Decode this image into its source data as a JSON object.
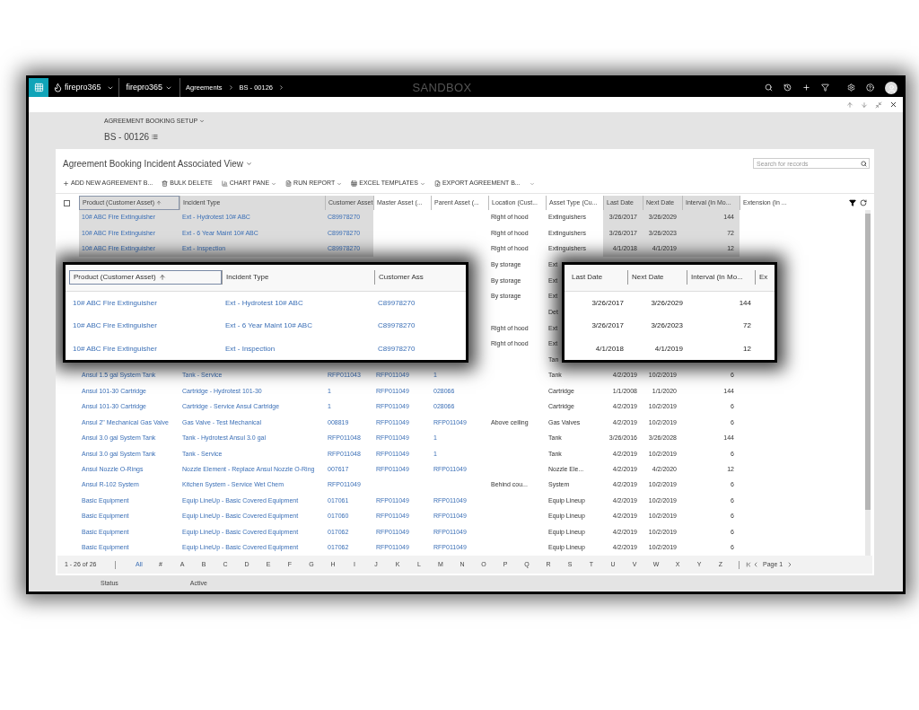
{
  "top_bar": {
    "app_name": "firepro365",
    "area": "firepro365",
    "breadcrumbs": [
      "Agreements",
      "BS - 00126"
    ],
    "environment": "SANDBOX"
  },
  "form": {
    "entity_label": "AGREEMENT BOOKING SETUP",
    "record_name": "BS - 00126"
  },
  "view": {
    "title": "Agreement Booking Incident Associated View",
    "search": {
      "placeholder": "Search for records"
    },
    "commands": [
      {
        "label": "ADD NEW AGREEMENT B...",
        "kind": "add",
        "has_menu": false
      },
      {
        "label": "BULK DELETE",
        "kind": "delete",
        "has_menu": false
      },
      {
        "label": "CHART PANE",
        "kind": "chart",
        "has_menu": true
      },
      {
        "label": "RUN REPORT",
        "kind": "report",
        "has_menu": true
      },
      {
        "label": "EXCEL TEMPLATES",
        "kind": "excel",
        "has_menu": true
      },
      {
        "label": "EXPORT AGREEMENT B...",
        "kind": "export",
        "has_menu": false
      }
    ],
    "columns": [
      {
        "label": "Product (Customer Asset)",
        "kind": "link",
        "highlighted": true,
        "sorted": true
      },
      {
        "label": "Incident Type",
        "kind": "link",
        "highlighted": true,
        "sorted": false
      },
      {
        "label": "Customer Asset",
        "kind": "link",
        "highlighted": true,
        "sorted": false
      },
      {
        "label": "Master Asset (...",
        "kind": "link",
        "highlighted": false,
        "sorted": false
      },
      {
        "label": "Parent Asset (...",
        "kind": "link",
        "highlighted": false,
        "sorted": false
      },
      {
        "label": "Location (Cust...",
        "kind": "text",
        "highlighted": false,
        "sorted": false
      },
      {
        "label": "Asset Type (Cu...",
        "kind": "text",
        "highlighted": false,
        "sorted": false
      },
      {
        "label": "Last Date",
        "kind": "number",
        "highlighted": true,
        "sorted": false
      },
      {
        "label": "Next Date",
        "kind": "number",
        "highlighted": true,
        "sorted": false
      },
      {
        "label": "Interval (In Mo...",
        "kind": "number",
        "highlighted": true,
        "sorted": false
      },
      {
        "label": "Extension (In ...",
        "highlighted": false,
        "sorted": false
      }
    ],
    "select_all": {
      "checked": false
    },
    "rows": [
      {
        "highlighted": true,
        "product": "10# ABC Fire Extinguisher",
        "incident_type": "Ext - Hydrotest 10# ABC",
        "customer_asset": "C89978270",
        "location": "Right of hood",
        "asset_type": "Extinguishers",
        "last_date": "3/26/2017",
        "next_date": "3/26/2029",
        "interval": "144"
      },
      {
        "highlighted": true,
        "product": "10# ABC Fire Extinguisher",
        "incident_type": "Ext - 6 Year Maint 10# ABC",
        "customer_asset": "C89978270",
        "location": "Right of hood",
        "asset_type": "Extinguishers",
        "last_date": "3/26/2017",
        "next_date": "3/26/2023",
        "interval": "72"
      },
      {
        "highlighted": true,
        "product": "10# ABC Fire Extinguisher",
        "incident_type": "Ext - Inspection",
        "customer_asset": "C89978270",
        "location": "Right of hood",
        "asset_type": "Extinguishers",
        "last_date": "4/1/2018",
        "next_date": "4/1/2019",
        "interval": "12"
      }
    ],
    "covered_rows": [
      {
        "location": "By storage",
        "asset_type": "Ext"
      },
      {
        "location": "By storage",
        "asset_type": "Ext"
      },
      {
        "location": "By storage",
        "asset_type": "Ext"
      },
      {
        "asset_type": "Det"
      },
      {
        "location": "Right of hood",
        "asset_type": "Ext"
      },
      {
        "location": "Right of hood",
        "asset_type": "Ext"
      },
      {
        "asset_type": "Tan"
      }
    ],
    "more_rows": [
      {
        "highlighted": false,
        "product": "Ansul 1.5 gal System Tank",
        "incident_type": "Tank - Service",
        "customer_asset": "RFP011043",
        "master_asset": "RFP011049",
        "parent_asset": "1",
        "asset_type": "Tank",
        "last_date": "4/2/2019",
        "next_date": "10/2/2019",
        "interval": "6"
      },
      {
        "highlighted": false,
        "product": "Ansul 101-30 Cartridge",
        "incident_type": "Cartridge - Hydrotest 101-30",
        "customer_asset": "1",
        "master_asset": "RFP011049",
        "parent_asset": "028066",
        "asset_type": "Cartridge",
        "last_date": "1/1/2008",
        "next_date": "1/1/2020",
        "interval": "144"
      },
      {
        "highlighted": false,
        "product": "Ansul 101-30 Cartridge",
        "incident_type": "Cartridge - Service Ansul Cartridge",
        "customer_asset": "1",
        "master_asset": "RFP011049",
        "parent_asset": "028066",
        "asset_type": "Cartridge",
        "last_date": "4/2/2019",
        "next_date": "10/2/2019",
        "interval": "6"
      },
      {
        "highlighted": false,
        "product": "Ansul 2\" Mechanical Gas Valve",
        "incident_type": "Gas Valve - Test Mechanical",
        "customer_asset": "008819",
        "master_asset": "RFP011049",
        "parent_asset": "RFP011049",
        "location": "Above ceiling",
        "asset_type": "Gas Valves",
        "last_date": "4/2/2019",
        "next_date": "10/2/2019",
        "interval": "6"
      },
      {
        "highlighted": false,
        "product": "Ansul 3.0 gal System Tank",
        "incident_type": "Tank - Hydrotest Ansul 3.0 gal",
        "customer_asset": "RFP011048",
        "master_asset": "RFP011049",
        "parent_asset": "1",
        "asset_type": "Tank",
        "last_date": "3/26/2016",
        "next_date": "3/26/2028",
        "interval": "144"
      },
      {
        "highlighted": false,
        "product": "Ansul 3.0 gal System Tank",
        "incident_type": "Tank - Service",
        "customer_asset": "RFP011048",
        "master_asset": "RFP011049",
        "parent_asset": "1",
        "asset_type": "Tank",
        "last_date": "4/2/2019",
        "next_date": "10/2/2019",
        "interval": "6"
      },
      {
        "highlighted": false,
        "product": "Ansul Nozzle O-Rings",
        "incident_type": "Nozzle Element - Replace Ansul Nozzle O-Ring",
        "customer_asset": "007617",
        "master_asset": "RFP011049",
        "parent_asset": "RFP011049",
        "asset_type": "Nozzle Ele...",
        "last_date": "4/2/2019",
        "next_date": "4/2/2020",
        "interval": "12"
      },
      {
        "highlighted": false,
        "product": "Ansul R-102 System",
        "incident_type": "Kitchen System - Service Wet Chem",
        "customer_asset": "RFP011049",
        "location": "Behind cou...",
        "asset_type": "System",
        "last_date": "4/2/2019",
        "next_date": "10/2/2019",
        "interval": "6"
      },
      {
        "highlighted": false,
        "product": "Basic Equipment",
        "incident_type": "Equip LineUp - Basic Covered Equipment",
        "customer_asset": "017061",
        "master_asset": "RFP011049",
        "parent_asset": "RFP011049",
        "asset_type": "Equip Lineup",
        "last_date": "4/2/2019",
        "next_date": "10/2/2019",
        "interval": "6"
      },
      {
        "highlighted": false,
        "product": "Basic Equipment",
        "incident_type": "Equip LineUp - Basic Covered Equipment",
        "customer_asset": "017060",
        "master_asset": "RFP011049",
        "parent_asset": "RFP011049",
        "asset_type": "Equip Lineup",
        "last_date": "4/2/2019",
        "next_date": "10/2/2019",
        "interval": "6"
      },
      {
        "highlighted": false,
        "product": "Basic Equipment",
        "incident_type": "Equip LineUp - Basic Covered Equipment",
        "customer_asset": "017062",
        "master_asset": "RFP011049",
        "parent_asset": "RFP011049",
        "asset_type": "Equip Lineup",
        "last_date": "4/2/2019",
        "next_date": "10/2/2019",
        "interval": "6"
      },
      {
        "highlighted": false,
        "product": "Basic Equipment",
        "incident_type": "Equip LineUp - Basic Covered Equipment",
        "customer_asset": "017062",
        "master_asset": "RFP011049",
        "parent_asset": "RFP011049",
        "asset_type": "Equip Lineup",
        "last_date": "4/2/2019",
        "next_date": "10/2/2019",
        "interval": "6"
      }
    ],
    "footer": {
      "count": "1 - 26 of 26",
      "letters": [
        {
          "label": "All",
          "selected": true
        },
        {
          "label": "#",
          "selected": false
        },
        {
          "label": "A",
          "selected": false
        },
        {
          "label": "B",
          "selected": false
        },
        {
          "label": "C",
          "selected": false
        },
        {
          "label": "D",
          "selected": false
        },
        {
          "label": "E",
          "selected": false
        },
        {
          "label": "F",
          "selected": false
        },
        {
          "label": "G",
          "selected": false
        },
        {
          "label": "H",
          "selected": false
        },
        {
          "label": "I",
          "selected": false
        },
        {
          "label": "J",
          "selected": false
        },
        {
          "label": "K",
          "selected": false
        },
        {
          "label": "L",
          "selected": false
        },
        {
          "label": "M",
          "selected": false
        },
        {
          "label": "N",
          "selected": false
        },
        {
          "label": "O",
          "selected": false
        },
        {
          "label": "P",
          "selected": false
        },
        {
          "label": "Q",
          "selected": false
        },
        {
          "label": "R",
          "selected": false
        },
        {
          "label": "S",
          "selected": false
        },
        {
          "label": "T",
          "selected": false
        },
        {
          "label": "U",
          "selected": false
        },
        {
          "label": "V",
          "selected": false
        },
        {
          "label": "W",
          "selected": false
        },
        {
          "label": "X",
          "selected": false
        },
        {
          "label": "Y",
          "selected": false
        },
        {
          "label": "Z",
          "selected": false
        }
      ],
      "page": "Page 1"
    }
  },
  "zoom_callouts": {
    "left": {
      "columns": [
        {
          "label": "Product (Customer Asset)",
          "sorted": true
        },
        {
          "label": "Incident Type",
          "sorted": false
        },
        {
          "label": "Customer Ass",
          "sorted": false
        }
      ],
      "rows": [
        [
          "10# ABC Fire Extinguisher",
          "Ext - Hydrotest 10# ABC",
          "C89978270"
        ],
        [
          "10# ABC Fire Extinguisher",
          "Ext - 6 Year Maint 10# ABC",
          "C89978270"
        ],
        [
          "10# ABC Fire Extinguisher",
          "Ext - Inspection",
          "C89978270"
        ]
      ]
    },
    "right": {
      "columns": [
        {
          "label": "Last Date",
          "sorted": false
        },
        {
          "label": "Next Date",
          "sorted": false
        },
        {
          "label": "Interval (In Mo...",
          "sorted": false
        },
        {
          "label": "Ex",
          "sorted": false
        }
      ],
      "rows": [
        [
          "3/26/2017",
          "3/26/2029",
          "144"
        ],
        [
          "3/26/2017",
          "3/26/2023",
          "72"
        ],
        [
          "4/1/2018",
          "4/1/2019",
          "12"
        ]
      ]
    }
  },
  "status_field": {
    "label": "Status",
    "value": "Active"
  }
}
